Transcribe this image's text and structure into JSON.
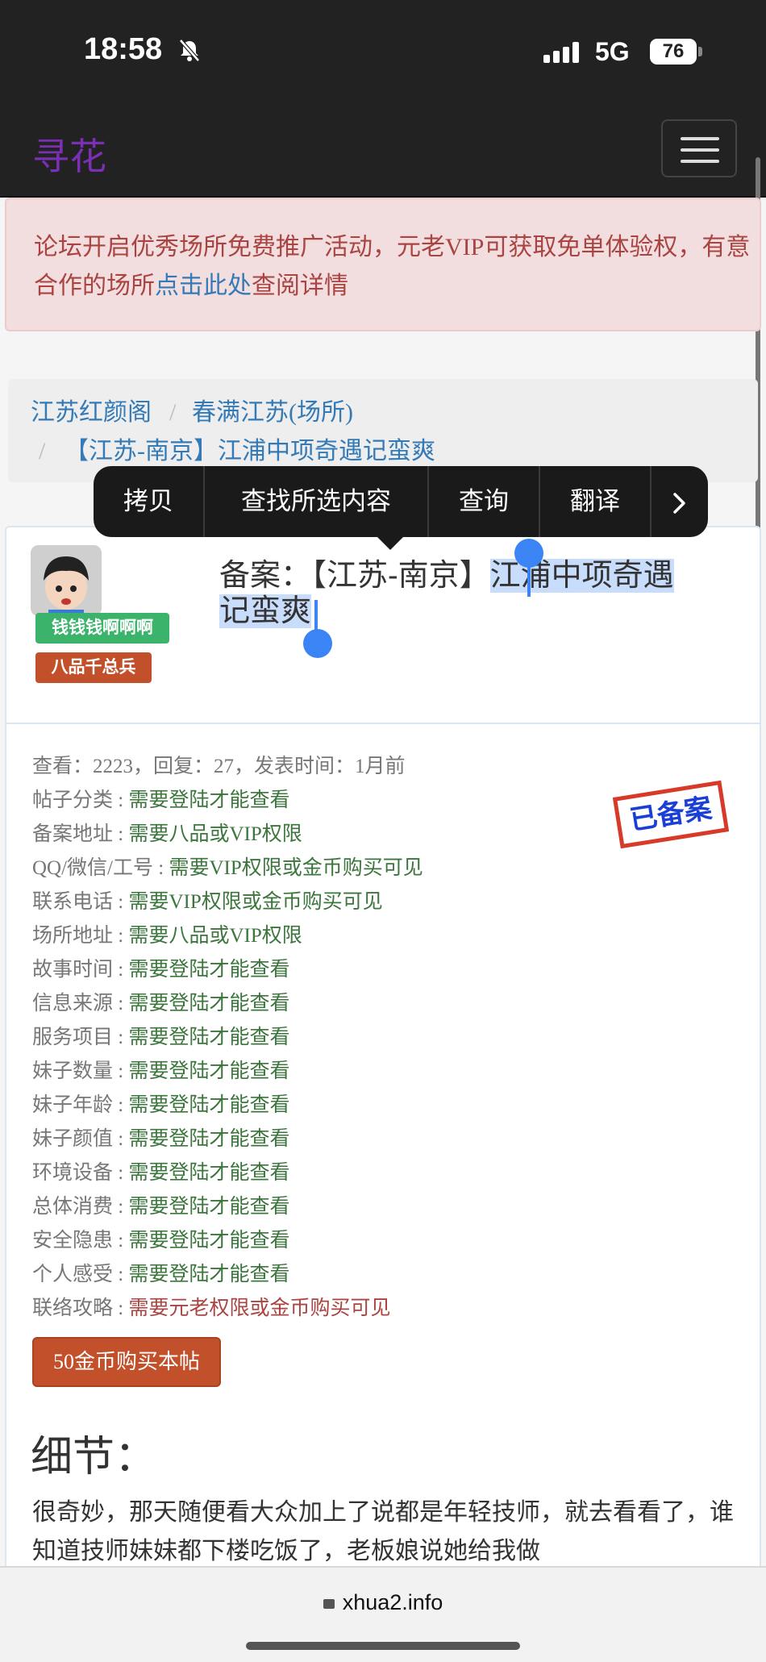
{
  "status_bar": {
    "time": "18:58",
    "network": "5G",
    "battery": "76"
  },
  "navbar": {
    "brand": "寻花"
  },
  "alert": {
    "text_before": "论坛开启优秀场所免费推广活动，元老VIP可获取免单体验权，有意合作的场所",
    "link": "点击此处",
    "text_after": "查阅详情"
  },
  "breadcrumb": {
    "items": [
      "江苏红颜阁",
      "春满江苏(场所)",
      "【江苏-南京】江浦中项奇遇记蛮爽"
    ]
  },
  "context_menu": {
    "items": [
      "拷贝",
      "查找所选内容",
      "查询",
      "翻译"
    ]
  },
  "user": {
    "name_badge": "钱钱钱啊啊啊",
    "rank_badge": "八品千总兵"
  },
  "post": {
    "title_prefix": "备案：【江苏-南京】",
    "title_selected_1": "江浦中项奇遇",
    "title_selected_2": "记蛮爽",
    "stamp": "已备案",
    "meta": "查看：2223，回复：27，发表时间：1月前",
    "fields": [
      {
        "label": "帖子分类",
        "value": "需要登陆才能查看",
        "color": "#3c763d"
      },
      {
        "label": "备案地址",
        "value": "需要八品或VIP权限",
        "color": "#3c763d"
      },
      {
        "label": "QQ/微信/工号",
        "value": "需要VIP权限或金币购买可见",
        "color": "#3c763d"
      },
      {
        "label": "联系电话",
        "value": "需要VIP权限或金币购买可见",
        "color": "#3c763d"
      },
      {
        "label": "场所地址",
        "value": "需要八品或VIP权限",
        "color": "#3c763d"
      },
      {
        "label": "故事时间",
        "value": "需要登陆才能查看",
        "color": "#3c763d"
      },
      {
        "label": "信息来源",
        "value": "需要登陆才能查看",
        "color": "#3c763d"
      },
      {
        "label": "服务项目",
        "value": "需要登陆才能查看",
        "color": "#3c763d"
      },
      {
        "label": "妹子数量",
        "value": "需要登陆才能查看",
        "color": "#3c763d"
      },
      {
        "label": "妹子年龄",
        "value": "需要登陆才能查看",
        "color": "#3c763d"
      },
      {
        "label": "妹子颜值",
        "value": "需要登陆才能查看",
        "color": "#3c763d"
      },
      {
        "label": "环境设备",
        "value": "需要登陆才能查看",
        "color": "#3c763d"
      },
      {
        "label": "总体消费",
        "value": "需要登陆才能查看",
        "color": "#3c763d"
      },
      {
        "label": "安全隐患",
        "value": "需要登陆才能查看",
        "color": "#3c763d"
      },
      {
        "label": "个人感受",
        "value": "需要登陆才能查看",
        "color": "#3c763d"
      },
      {
        "label": "联络攻略",
        "value": "需要元老权限或金币购买可见",
        "color": "#a94442"
      }
    ],
    "buy_button": "50金币购买本帖",
    "detail_heading": "细节：",
    "detail_text": "很奇妙，那天随便看大众加上了说都是年轻技师，就去看看了，谁知道技师妹妹都下楼吃饭了，老板娘说她给我做"
  },
  "browser": {
    "url": "xhua2.info"
  }
}
